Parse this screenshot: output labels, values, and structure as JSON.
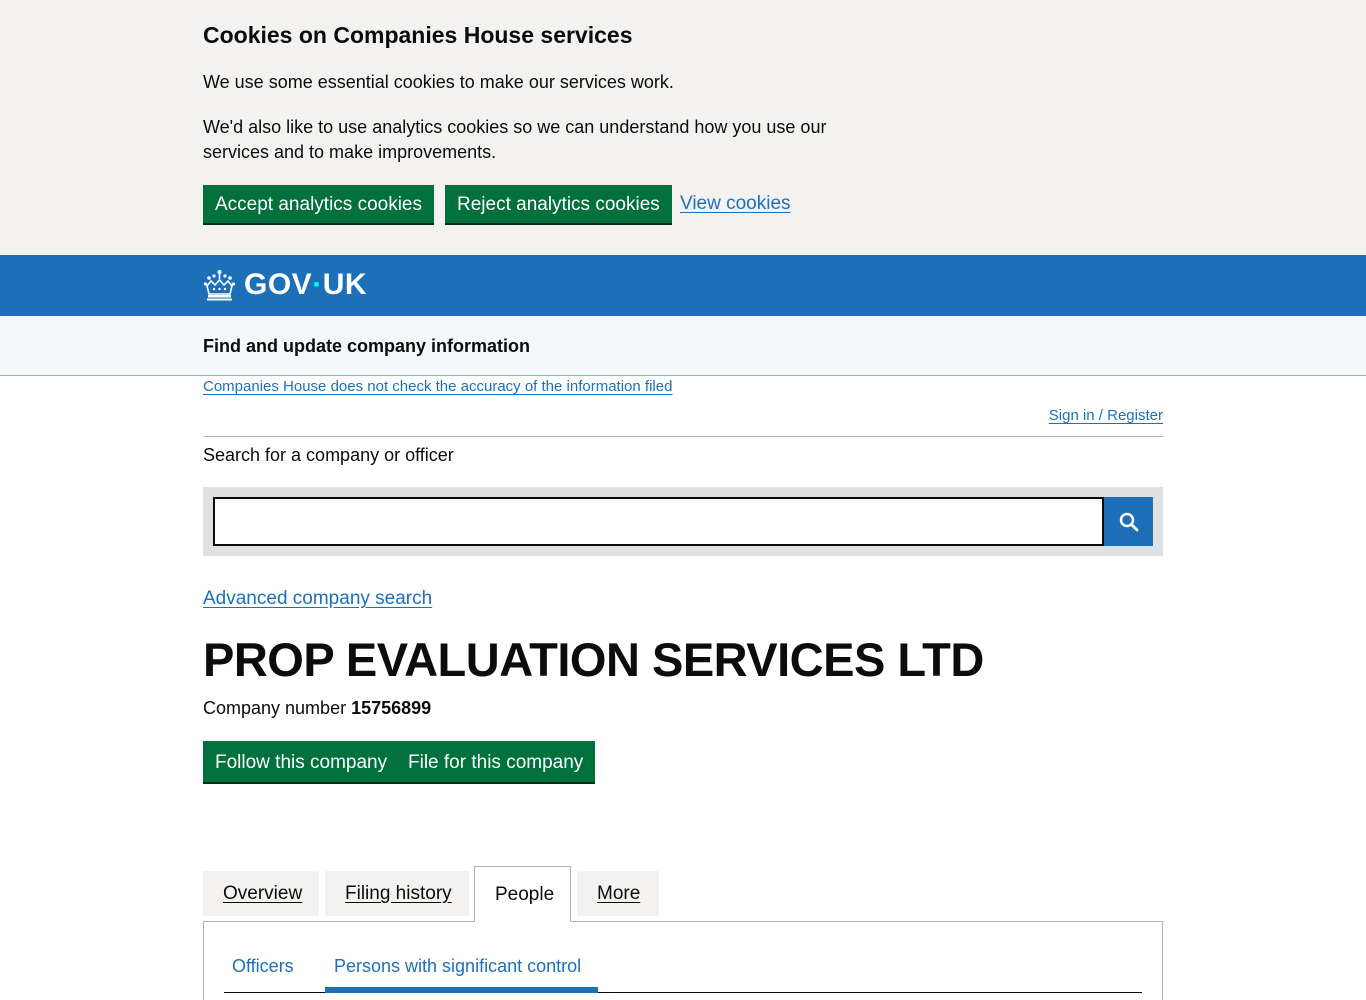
{
  "cookie_banner": {
    "title": "Cookies on Companies House services",
    "paragraph1": "We use some essential cookies to make our services work.",
    "paragraph2": "We'd also like to use analytics cookies so we can understand how you use our services and to make improvements.",
    "accept_label": "Accept analytics cookies",
    "reject_label": "Reject analytics cookies",
    "view_label": "View cookies"
  },
  "header": {
    "logo_text_left": "GOV",
    "logo_dot": "·",
    "logo_text_right": "UK",
    "service_name": "Find and update company information"
  },
  "notices": {
    "accuracy_link": "Companies House does not check the accuracy of the information filed",
    "signin_link": "Sign in / Register"
  },
  "search": {
    "label": "Search for a company or officer",
    "value": "",
    "advanced_link": "Advanced company search"
  },
  "company": {
    "name": "PROP EVALUATION SERVICES LTD",
    "number_label": "Company number",
    "number": "15756899",
    "follow_label": "Follow this company",
    "file_label": "File for this company"
  },
  "tabs": {
    "overview": "Overview",
    "filing_history": "Filing history",
    "people": "People",
    "more": "More",
    "active": "People"
  },
  "subtabs": {
    "officers": "Officers",
    "psc": "Persons with significant control",
    "active": "Persons with significant control"
  },
  "colors": {
    "brand_blue": "#1d70b8",
    "button_green": "#00703c",
    "banner_grey": "#f3f2f1"
  }
}
